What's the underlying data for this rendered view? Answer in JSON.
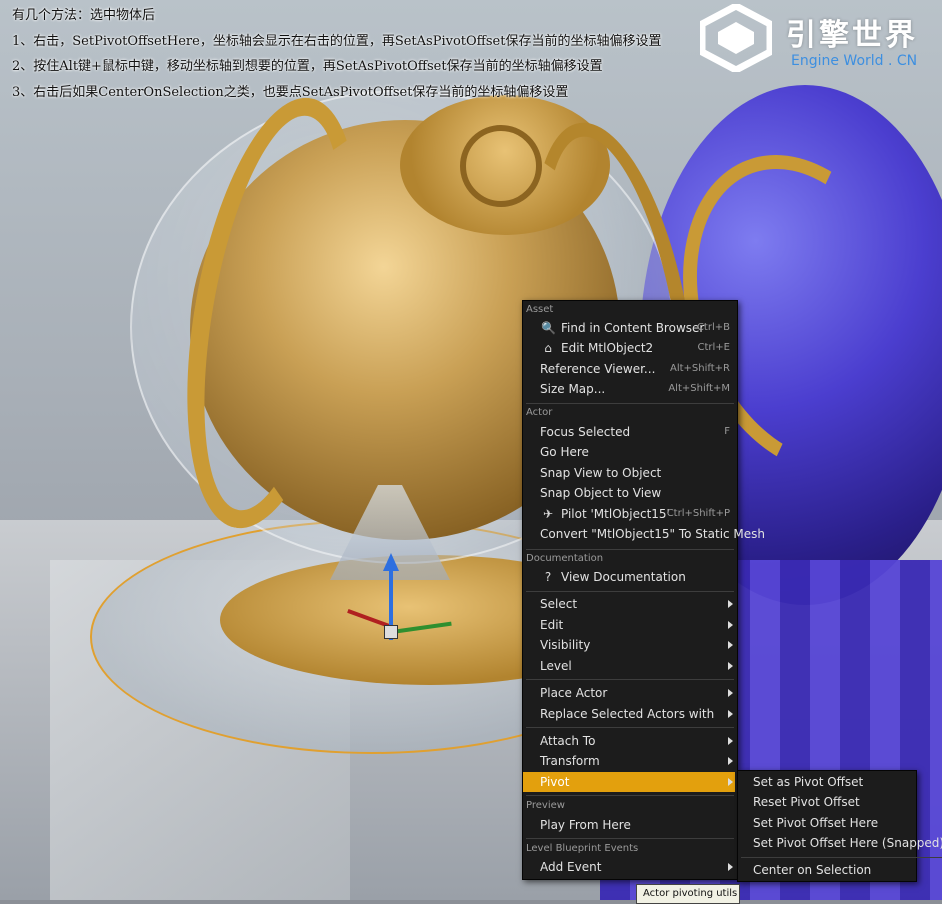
{
  "overlay": {
    "line0": "有几个方法：选中物体后",
    "line1": "1、右击，SetPivotOffsetHere，坐标轴会显示在右击的位置，再SetAsPivotOffset保存当前的坐标轴偏移设置",
    "line2": "2、按住Alt键+鼠标中键，移动坐标轴到想要的位置，再SetAsPivotOffset保存当前的坐标轴偏移设置",
    "line3": "3、右击后如果CenterOnSelection之类，也要点SetAsPivotOffset保存当前的坐标轴偏移设置"
  },
  "logo": {
    "cn": "引擎世界",
    "en": "Engine World . CN"
  },
  "context_menu": {
    "section_asset": "Asset",
    "find_in_content_browser": {
      "label": "Find in Content Browser",
      "shortcut": "Ctrl+B",
      "icon": "search-icon"
    },
    "edit_object": {
      "label": "Edit MtlObject2",
      "shortcut": "Ctrl+E",
      "icon": "edit-icon"
    },
    "reference_viewer": {
      "label": "Reference Viewer...",
      "shortcut": "Alt+Shift+R"
    },
    "size_map": {
      "label": "Size Map...",
      "shortcut": "Alt+Shift+M"
    },
    "section_actor": "Actor",
    "focus_selected": {
      "label": "Focus Selected",
      "shortcut": "F"
    },
    "go_here": {
      "label": "Go Here"
    },
    "snap_view_to_object": {
      "label": "Snap View to Object"
    },
    "snap_object_to_view": {
      "label": "Snap Object to View"
    },
    "pilot": {
      "label": "Pilot 'MtlObject15'",
      "shortcut": "Ctrl+Shift+P",
      "icon": "airplane-icon"
    },
    "convert_static_mesh": {
      "label": "Convert \"MtlObject15\" To Static Mesh"
    },
    "section_documentation": "Documentation",
    "view_documentation": {
      "label": "View Documentation",
      "icon": "help-icon"
    },
    "select": {
      "label": "Select"
    },
    "edit": {
      "label": "Edit"
    },
    "visibility": {
      "label": "Visibility"
    },
    "level": {
      "label": "Level"
    },
    "place_actor": {
      "label": "Place Actor"
    },
    "replace_selected_actors": {
      "label": "Replace Selected Actors with"
    },
    "attach_to": {
      "label": "Attach To"
    },
    "transform": {
      "label": "Transform"
    },
    "pivot": {
      "label": "Pivot"
    },
    "section_preview": "Preview",
    "play_from_here": {
      "label": "Play From Here"
    },
    "section_level_blueprint_events": "Level Blueprint Events",
    "add_event": {
      "label": "Add Event"
    }
  },
  "pivot_submenu": {
    "set_as_pivot_offset": "Set as Pivot Offset",
    "reset_pivot_offset": "Reset Pivot Offset",
    "set_pivot_offset_here": "Set Pivot Offset Here",
    "set_pivot_offset_here_snapped": "Set Pivot Offset Here (Snapped)",
    "center_on_selection": "Center on Selection"
  },
  "tooltip": "Actor pivoting utils",
  "colors": {
    "menu_bg": "#1c1c1c",
    "highlight": "#e3a00d",
    "logo_blue": "#3d8fe0"
  }
}
